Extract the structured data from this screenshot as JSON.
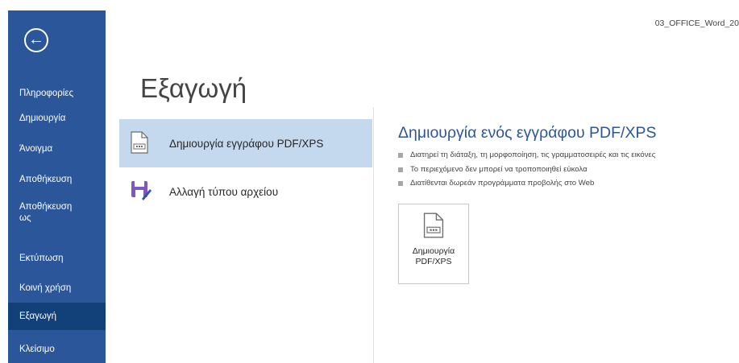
{
  "window": {
    "document_title": "03_OFFICE_Word_20"
  },
  "sidebar": {
    "back_icon": "arrow-left-circle-icon",
    "items": [
      {
        "label": "Πληροφορίες"
      },
      {
        "label": "Δημιουργία"
      },
      {
        "label": "Άνοιγμα"
      },
      {
        "label": "Αποθήκευση"
      },
      {
        "label": "Αποθήκευση ως"
      },
      {
        "label": "Εκτύπωση"
      },
      {
        "label": "Κοινή χρήση"
      },
      {
        "label": "Εξαγωγή",
        "active": true
      },
      {
        "label": "Κλείσιμο"
      }
    ],
    "colors": {
      "background": "#2b579a",
      "active": "#124078"
    }
  },
  "main": {
    "title": "Εξαγωγή",
    "options": [
      {
        "label": "Δημιουργία εγγράφου PDF/XPS",
        "icon": "pdf-document-icon",
        "selected": true
      },
      {
        "label": "Αλλαγή τύπου αρχείου",
        "icon": "save-as-file-type-icon",
        "selected": false
      }
    ],
    "detail": {
      "title": "Δημιουργία ενός εγγράφου PDF/XPS",
      "bullets": [
        "Διατηρεί τη διάταξη, τη μορφοποίηση, τις γραμματοσειρές και τις εικόνες",
        "Το περιεχόμενο δεν μπορεί να τροποποιηθεί εύκολα",
        "Διατίθενται δωρεάν προγράμματα προβολής στο Web"
      ],
      "button": {
        "line1": "Δημιουργία",
        "line2": "PDF/XPS",
        "icon": "pdf-document-icon"
      }
    },
    "colors": {
      "accent": "#2b579a",
      "selected_option": "#c5d9ee"
    }
  }
}
